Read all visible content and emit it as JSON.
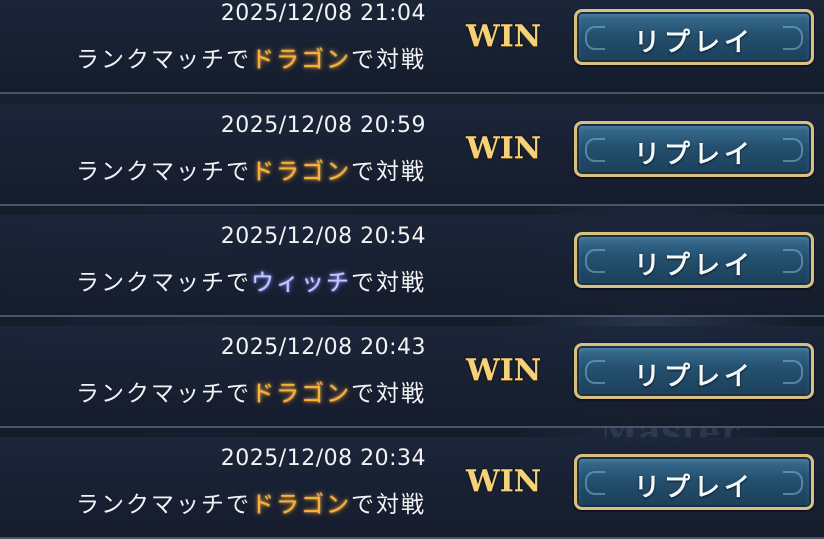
{
  "history": {
    "items": [
      {
        "datetime": "2025/12/08 21:04",
        "prefix": "ランクマッチで",
        "opponent": "ドラゴン",
        "opponent_class": "dragon",
        "suffix": "で対戦",
        "result": "WIN",
        "replay_label": "リプレイ"
      },
      {
        "datetime": "2025/12/08 20:59",
        "prefix": "ランクマッチで",
        "opponent": "ドラゴン",
        "opponent_class": "dragon",
        "suffix": "で対戦",
        "result": "WIN",
        "replay_label": "リプレイ"
      },
      {
        "datetime": "2025/12/08 20:54",
        "prefix": "ランクマッチで",
        "opponent": "ウィッチ",
        "opponent_class": "witch",
        "suffix": "で対戦",
        "result": "",
        "replay_label": "リプレイ"
      },
      {
        "datetime": "2025/12/08 20:43",
        "prefix": "ランクマッチで",
        "opponent": "ドラゴン",
        "opponent_class": "dragon",
        "suffix": "で対戦",
        "result": "WIN",
        "replay_label": "リプレイ"
      },
      {
        "datetime": "2025/12/08 20:34",
        "prefix": "ランクマッチで",
        "opponent": "ドラゴン",
        "opponent_class": "dragon",
        "suffix": "で対戦",
        "result": "WIN",
        "replay_label": "リプレイ"
      }
    ]
  },
  "background": {
    "watermark": "Master"
  },
  "colors": {
    "dragon": "#ffb03a",
    "witch": "#c5c8ff",
    "win": "#f5d27a",
    "button_border": "#d9bf80"
  }
}
